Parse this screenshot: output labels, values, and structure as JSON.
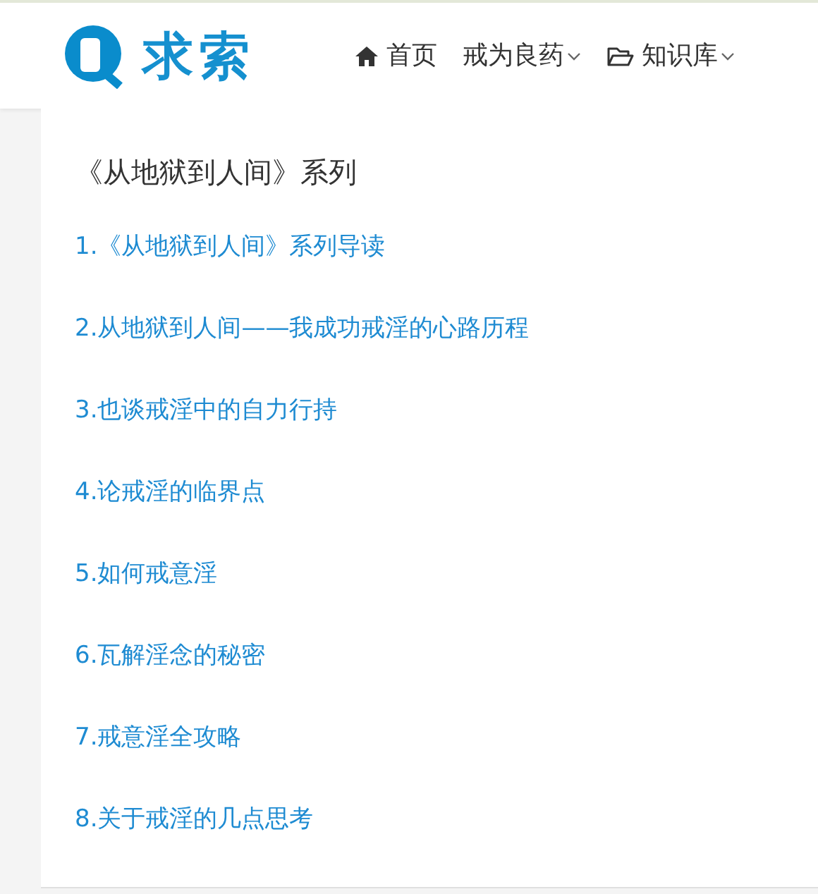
{
  "logo": {
    "text": "求索"
  },
  "nav": [
    {
      "label": "首页",
      "kind": "home"
    },
    {
      "label": "戒为良药",
      "kind": "dropdown"
    },
    {
      "label": "知识库",
      "kind": "folder-dropdown"
    }
  ],
  "section": {
    "title": "《从地狱到人间》系列",
    "links": [
      "1.《从地狱到人间》系列导读",
      "2.从地狱到人间——我成功戒淫的心路历程",
      "3.也谈戒淫中的自力行持",
      "4.论戒淫的临界点",
      "5.如何戒意淫",
      "6.瓦解淫念的秘密",
      "7.戒意淫全攻略",
      "8.关于戒淫的几点思考"
    ]
  }
}
